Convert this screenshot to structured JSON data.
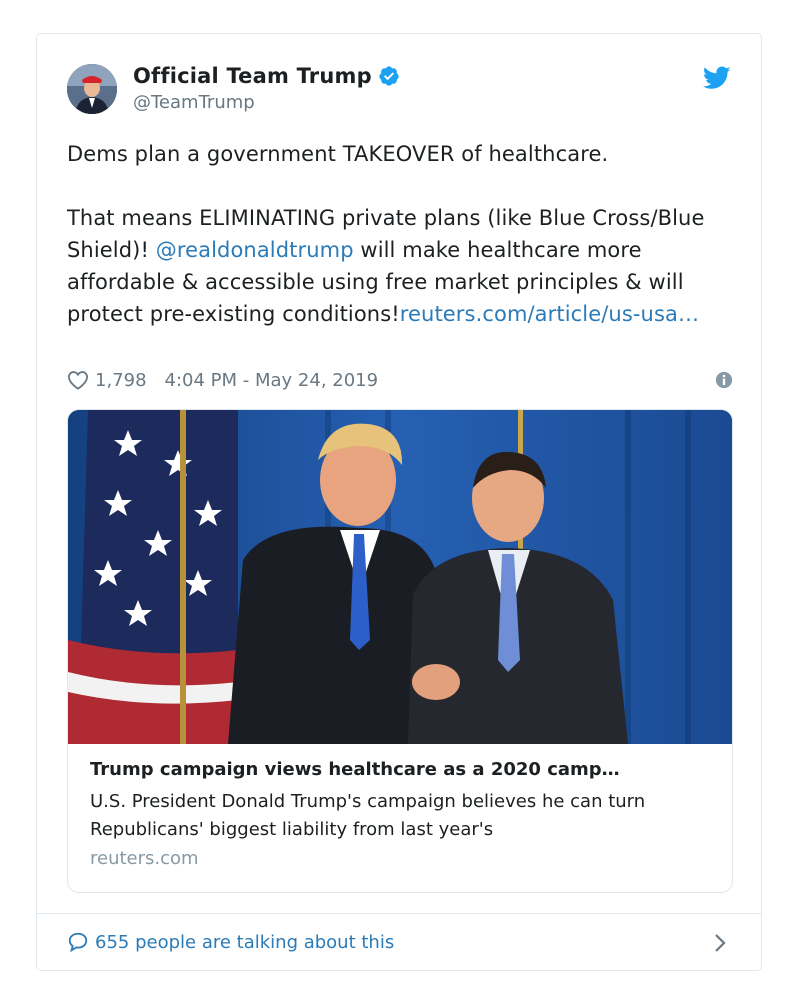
{
  "account": {
    "display_name": "Official Team Trump",
    "handle": "@TeamTrump"
  },
  "tweet": {
    "line1": "Dems plan a government TAKEOVER of healthcare.",
    "para2_part1": "That means ELIMINATING private plans (like Blue Cross/Blue Shield)! ",
    "mention": "@realdonaldtrump",
    "para2_part2": " will make healthcare more affordable & accessible using free market principles & will protect pre-existing conditions!",
    "link": "reuters.com/article/us-usa…"
  },
  "meta": {
    "likes": "1,798",
    "timestamp": "4:04 PM - May 24, 2019"
  },
  "link_card": {
    "title": "Trump campaign views healthcare as a 2020 camp…",
    "description": "U.S. President Donald Trump's campaign believes he can turn Republicans' biggest liability from last year's",
    "domain": "reuters.com"
  },
  "footer": {
    "talking": "655 people are talking about this"
  },
  "colors": {
    "link_blue": "#2b7bb9",
    "twitter_blue": "#1da1f2",
    "secondary_text": "#697882",
    "border": "#e1e8ed"
  },
  "icons": {
    "verified": "verified-badge-icon",
    "brand": "twitter-bird-icon",
    "like": "heart-icon",
    "info": "info-icon",
    "talk": "speech-bubble-icon",
    "chevron": "chevron-right-icon"
  }
}
